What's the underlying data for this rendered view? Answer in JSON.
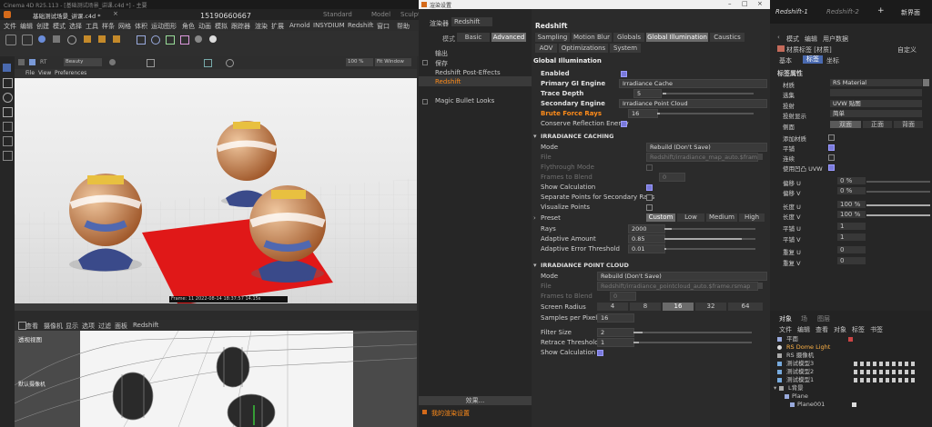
{
  "c4d": {
    "window_title": "Cinema 4D R25.113 - [基础测试场景_讲课.c4d *] - 主要",
    "file_tab": "基础测试场景_讲课.c4d *",
    "phone": "15190660667",
    "layouts": [
      "Standard",
      "Model",
      "Sculpt"
    ],
    "menu": [
      "文件",
      "编辑",
      "创建",
      "模式",
      "选择",
      "工具",
      "样条",
      "网格",
      "体积",
      "运动图形",
      "角色",
      "动画",
      "模拟",
      "跟踪器",
      "渲染",
      "扩展",
      "Arnold",
      "INSYDIUM",
      "Redshift",
      "窗口",
      "帮助"
    ],
    "vp1_menu": [
      "File",
      "View",
      "Preferences"
    ],
    "vp1_dropdown": "Beauty",
    "vp1_zoom": "100 %",
    "vp1_fit": "Fit Window",
    "render_status": "Frame: 11   2022-08-14  18:37:57  14.15s",
    "vp2_menu": [
      "查看",
      "摄像机",
      "显示",
      "选项",
      "过滤",
      "面板",
      "Redshift"
    ],
    "vp2_label": "透视视图",
    "vp2_camera": "默认摄像机"
  },
  "rs": {
    "window_title": "渲染设置",
    "renderer_label": "渲染器",
    "renderer_value": "Redshift",
    "mode_tabs": [
      "模式",
      "Basic",
      "Advanced"
    ],
    "left_items": [
      "输出",
      "保存",
      "Redshift Post-Effects",
      "Redshift",
      "Magic Bullet Looks"
    ],
    "effect_button": "效果...",
    "my_settings": "我的渲染设置",
    "panel_title": "Redshift",
    "tabs_row1": [
      "Sampling",
      "Motion Blur",
      "Globals",
      "Global Illumination",
      "Caustics"
    ],
    "tabs_row2": [
      "AOV",
      "Optimizations",
      "System"
    ],
    "section_title": "Global Illumination",
    "gi": {
      "enabled_label": "Enabled",
      "primary_label": "Primary GI Engine",
      "primary_value": "Irradiance Cache",
      "trace_label": "Trace Depth",
      "trace_value": "5",
      "secondary_label": "Secondary Engine",
      "secondary_value": "Irradiance Point Cloud",
      "brute_label": "Brute Force Rays",
      "brute_value": "16",
      "conserve_label": "Conserve Reflection Energy"
    },
    "ic": {
      "header": "IRRADIANCE CACHING",
      "mode_label": "Mode",
      "mode_value": "Rebuild (Don't Save)",
      "file_label": "File",
      "file_value": "Redshift/irradiance_map_auto.$fram",
      "fly_label": "Flythrough Mode",
      "frames_label": "Frames to Blend",
      "frames_value": "0",
      "show_label": "Show Calculation",
      "sep_label": "Separate Points for Secondary Rays",
      "vis_label": "Visualize Points",
      "preset_label": "Preset",
      "presets": [
        "Custom",
        "Low",
        "Medium",
        "High"
      ],
      "rays_label": "Rays",
      "rays_value": "2000",
      "amount_label": "Adaptive Amount",
      "amount_value": "0.85",
      "err_label": "Adaptive Error Threshold",
      "err_value": "0.01"
    },
    "ipc": {
      "header": "IRRADIANCE POINT CLOUD",
      "mode_label": "Mode",
      "mode_value": "Rebuild (Don't Save)",
      "file_label": "File",
      "file_value": "Redshift/irradiance_pointcloud_auto.$frame.rsmap",
      "frames_label": "Frames to Blend",
      "frames_value": "0",
      "radius_label": "Screen Radius",
      "radius_options": [
        "4",
        "8",
        "16",
        "32",
        "64"
      ],
      "spp_label": "Samples per Pixel",
      "spp_value": "16",
      "filter_label": "Filter Size",
      "filter_value": "2",
      "retrace_label": "Retrace Threshold",
      "retrace_value": "1",
      "showcalc_label": "Show Calculation"
    }
  },
  "am": {
    "tabs": [
      "Redshift-1",
      "Redshift-2"
    ],
    "new_button": "新界面",
    "menu": [
      "模式",
      "编辑",
      "用户数据"
    ],
    "title": "材质标签 [材质]",
    "custom": "自定义",
    "subtabs": [
      "基本",
      "标签",
      "坐标"
    ],
    "section": "标签属性",
    "props": [
      {
        "label": "材质",
        "value": "RS Material"
      },
      {
        "label": "选集",
        "value": ""
      },
      {
        "label": "投射",
        "value": "UVW 贴图"
      },
      {
        "label": "投射显示",
        "value": "简单"
      },
      {
        "label": "侧面",
        "value": "双面"
      }
    ],
    "side_options": [
      "双面",
      "正面",
      "背面"
    ],
    "checks": [
      "添加材质",
      "平铺",
      "连续",
      "使用凹凸 UVW"
    ],
    "offsets": [
      {
        "label": "偏移 U",
        "value": "0 %"
      },
      {
        "label": "偏移 V",
        "value": "0 %"
      },
      {
        "label": "长度 U",
        "value": "100 %"
      },
      {
        "label": "长度 V",
        "value": "100 %"
      },
      {
        "label": "平铺 U",
        "value": "1"
      },
      {
        "label": "平铺 V",
        "value": "1"
      },
      {
        "label": "重复 U",
        "value": "0"
      },
      {
        "label": "重复 V",
        "value": "0"
      }
    ],
    "obj_tabs": [
      "对象",
      "场",
      "图层"
    ],
    "obj_menu": [
      "文件",
      "编辑",
      "查看",
      "对象",
      "标签",
      "书签"
    ],
    "objects": [
      "平面",
      "RS Dome Light",
      "RS 摄像机",
      "测试模型3",
      "测试模型2",
      "测试模型1",
      "L背景",
      "Plane",
      "Plane001"
    ]
  }
}
